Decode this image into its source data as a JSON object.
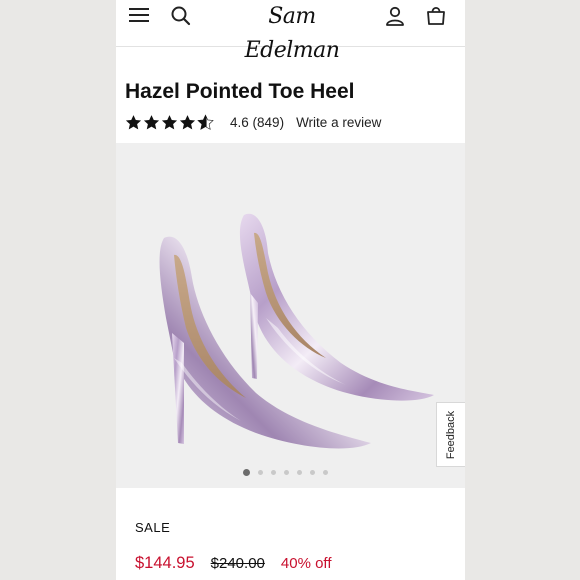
{
  "header": {
    "logo_text": "Sam Edelman",
    "icons": [
      "menu-icon",
      "search-icon",
      "account-icon",
      "bag-icon"
    ]
  },
  "product": {
    "title": "Hazel Pointed Toe Heel",
    "rating": "4.6",
    "review_count": "(849)",
    "rating_stars": 4.6,
    "write_review": "Write a review",
    "image_count": 7,
    "active_image": 1
  },
  "feedback": {
    "label": "Feedback"
  },
  "pricing": {
    "sale_label": "SALE",
    "sale_price": "$144.95",
    "original_price": "$240.00",
    "discount": "40% off"
  },
  "colors": {
    "sale_red": "#c8102e",
    "star": "#111111",
    "image_bg": "#efefef"
  }
}
